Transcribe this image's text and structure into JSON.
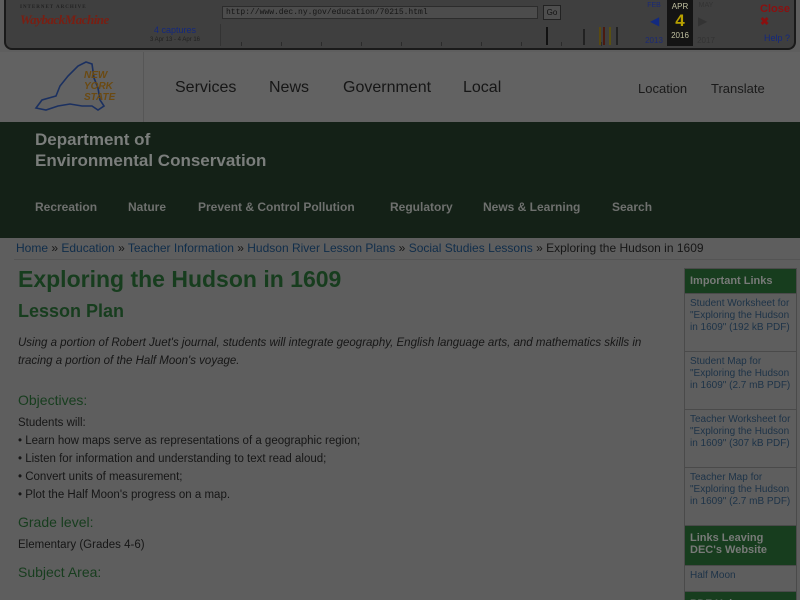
{
  "wayback": {
    "logo_small": "INTERNET ARCHIVE",
    "logo_big": "WaybackMachine",
    "url": "http://www.dec.ny.gov/education/70215.html",
    "go": "Go",
    "captures": "4 captures",
    "capture_range": "3 Apr 13 - 4 Apr 16",
    "prev_month": "FEB",
    "prev_year": "2013",
    "cur_month": "APR",
    "cur_day": "4",
    "cur_year": "2016",
    "next_month": "MAY",
    "next_year": "2017",
    "close": "Close",
    "help": "Help",
    "colors": {
      "cur_day": "#b7a000",
      "link": "#14287e"
    }
  },
  "header": {
    "logo": "NEW YORK STATE",
    "nav": [
      "Services",
      "News",
      "Government",
      "Local"
    ],
    "right": [
      "Location",
      "Translate"
    ]
  },
  "dec": {
    "title_line1": "Department of",
    "title_line2": "Environmental Conservation",
    "nav": [
      "Recreation",
      "Nature",
      "Prevent & Control Pollution",
      "Regulatory",
      "News & Learning",
      "Search"
    ]
  },
  "breadcrumb": {
    "links": [
      "Home",
      "Education",
      "Teacher Information",
      "Hudson River Lesson Plans",
      "Social Studies Lessons"
    ],
    "sep": " » ",
    "current": "Exploring the Hudson in 1609"
  },
  "main": {
    "title": "Exploring the Hudson in 1609",
    "subtitle": "Lesson Plan",
    "intro": "Using a portion of Robert Juet's journal, students will integrate geography, English language arts, and mathematics skills in tracing a portion of the Half Moon's voyage.",
    "objectives_heading": "Objectives:",
    "students_will": "Students will:",
    "objectives": [
      "• Learn how maps serve as representations of a geographic region;",
      "• Listen for information and understanding to text read aloud;",
      "• Convert units of measurement;",
      "• Plot the Half Moon's progress on a map."
    ],
    "grade_heading": "Grade level:",
    "grade": "Elementary (Grades 4-6)",
    "subject_heading": "Subject Area:"
  },
  "sidebar": {
    "heading": "Important Links",
    "links": [
      "Student Worksheet for \"Exploring the Hudson in 1609\" (192 kB PDF)",
      "Student Map for \"Exploring the Hudson in 1609\" (2.7 mB PDF)",
      "Teacher Worksheet for \"Exploring the Hudson in 1609\" (307 kB PDF)",
      "Teacher Map for \"Exploring the Hudson in 1609\" (2.7 mB PDF)"
    ],
    "leaving_heading": "Links Leaving DEC's Website",
    "leaving_links": [
      "Half Moon"
    ],
    "pdf_heading": "PDF Help"
  }
}
